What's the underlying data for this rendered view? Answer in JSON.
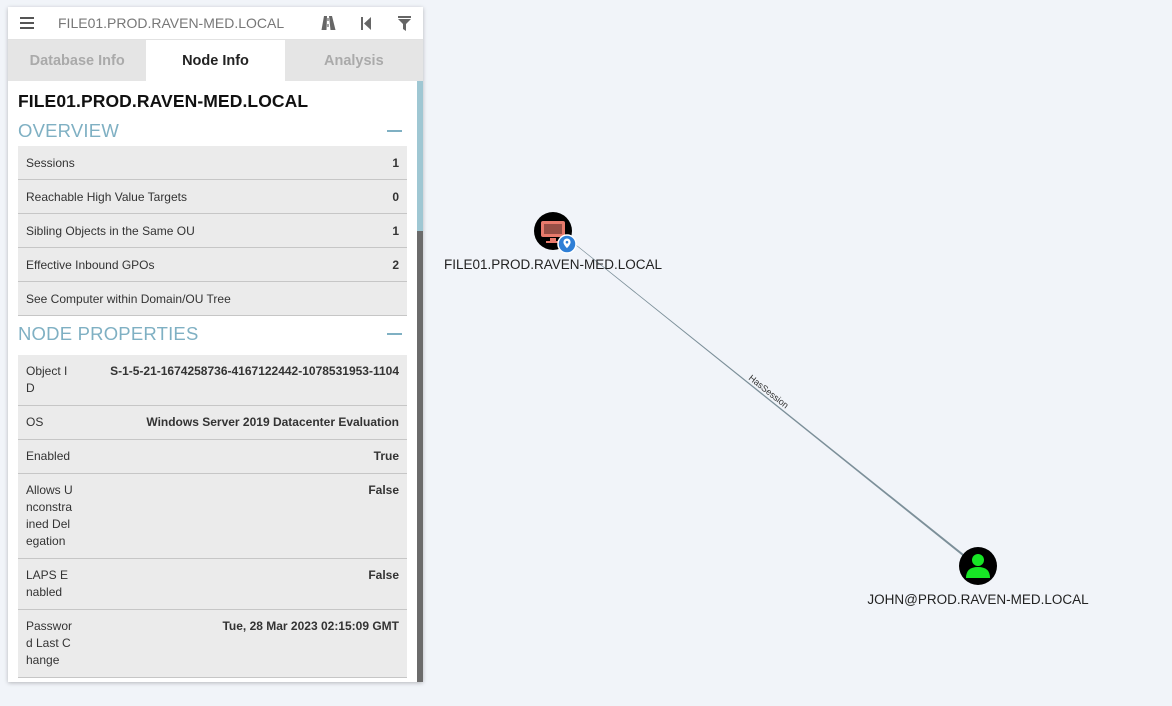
{
  "search": {
    "value": "FILE01.PROD.RAVEN-MED.LOCAL"
  },
  "toolbar": {
    "pathfinding_icon": "road-icon",
    "back_icon": "back-icon",
    "filter_icon": "filter-icon"
  },
  "tabs": [
    {
      "label": "Database Info"
    },
    {
      "label": "Node Info"
    },
    {
      "label": "Analysis"
    }
  ],
  "node": {
    "title": "FILE01.PROD.RAVEN-MED.LOCAL"
  },
  "overview": {
    "title": "OVERVIEW",
    "rows": [
      {
        "label": "Sessions",
        "value": "1"
      },
      {
        "label": "Reachable High Value Targets",
        "value": "0"
      },
      {
        "label": "Sibling Objects in the Same OU",
        "value": "1"
      },
      {
        "label": "Effective Inbound GPOs",
        "value": "2"
      },
      {
        "label": "See Computer within Domain/OU Tree",
        "value": ""
      }
    ]
  },
  "properties": {
    "title": "NODE PROPERTIES",
    "rows": [
      {
        "label": "Object ID",
        "value": "S-1-5-21-1674258736-4167122442-1078531953-1104"
      },
      {
        "label": "OS",
        "value": "Windows Server 2019 Datacenter Evaluation"
      },
      {
        "label": "Enabled",
        "value": "True"
      },
      {
        "label": "Allows Unconstrained Delegation",
        "value": "False"
      },
      {
        "label": "LAPS Enabled",
        "value": "False"
      },
      {
        "label": "Password Last Change",
        "value": "Tue, 28 Mar 2023 02:15:09 GMT"
      }
    ]
  },
  "graph": {
    "nodes": [
      {
        "label": "FILE01.PROD.RAVEN-MED.LOCAL",
        "type": "computer",
        "color": "#e87a6c"
      },
      {
        "label": "JOHN@PROD.RAVEN-MED.LOCAL",
        "type": "user",
        "color": "#17e625"
      }
    ],
    "edge": {
      "label": "HasSession"
    }
  }
}
